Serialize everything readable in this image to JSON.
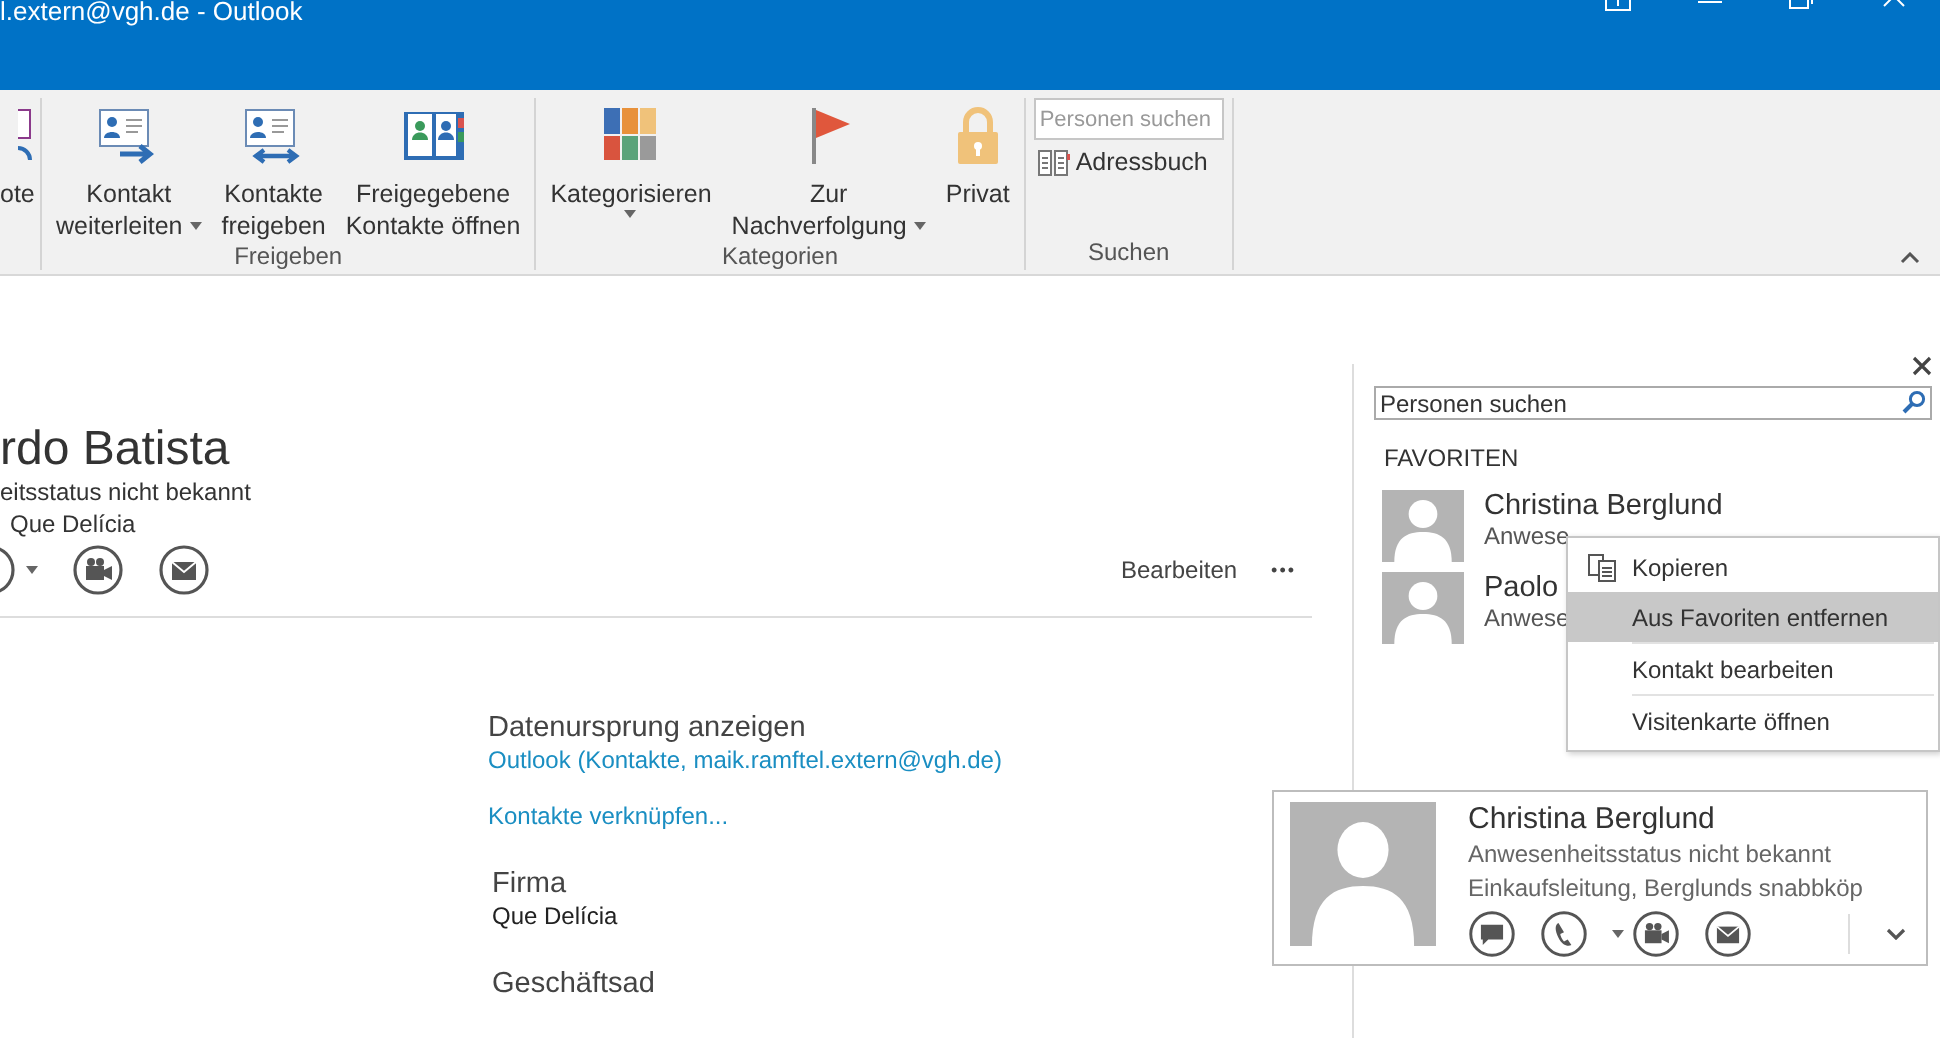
{
  "window": {
    "title": "l.extern@vgh.de - Outlook"
  },
  "ribbon": {
    "groups": [
      {
        "buttons": [
          {
            "kind": "partial",
            "lines": [
              "ote"
            ],
            "dropdown": false
          }
        ]
      },
      {
        "label": "Freigeben",
        "buttons": [
          {
            "kind": "forward",
            "lines": [
              "Kontakt",
              "weiterleiten"
            ],
            "dropdown": true
          },
          {
            "kind": "share",
            "lines": [
              "Kontakte",
              "freigeben"
            ],
            "dropdown": false
          },
          {
            "kind": "book",
            "lines": [
              "Freigegebene",
              "Kontakte öffnen"
            ],
            "dropdown": false
          }
        ]
      },
      {
        "label": "Kategorien",
        "buttons": [
          {
            "kind": "grid",
            "lines": [
              "Kategorisieren"
            ],
            "dropdown": true
          },
          {
            "kind": "flag",
            "lines": [
              "Zur",
              "Nachverfolgung"
            ],
            "dropdown": true
          },
          {
            "kind": "lock",
            "lines": [
              "Privat"
            ],
            "dropdown": false
          }
        ]
      },
      {
        "label": "Suchen",
        "search": {
          "placeholder": "Personen suchen"
        },
        "link": "Adressbuch"
      }
    ]
  },
  "contact": {
    "name": "rdo Batista",
    "presence": "eitsstatus nicht bekannt",
    "company": "Que Delícia",
    "edit": "Bearbeiten",
    "more": "•••"
  },
  "details": [
    {
      "heading": "Datenursprung anzeigen",
      "link": "Outlook (Kontakte, maik.ramftel.extern@vgh.de)"
    },
    {
      "link": "Kontakte verknüpfen..."
    },
    {
      "heading": "Firma",
      "value": "Que Delícia"
    },
    {
      "heading": "Geschäftsad"
    }
  ],
  "people_pane": {
    "search": {
      "placeholder": "Personen suchen"
    },
    "heading": "FAVORITEN",
    "favorites": [
      {
        "name": "Christina Berglund",
        "status": "Anwese"
      },
      {
        "name": "Paolo",
        "status": "Anwese"
      }
    ]
  },
  "context_menu": [
    {
      "label": "Kopieren",
      "icon": true,
      "selected": false
    },
    {
      "label": "Aus Favoriten entfernen",
      "icon": false,
      "selected": true
    },
    {
      "label": "Kontakt bearbeiten",
      "icon": false,
      "selected": false
    },
    {
      "label": "Visitenkarte öffnen",
      "icon": false,
      "selected": false
    }
  ],
  "contact_card": {
    "name": "Christina Berglund",
    "status": "Anwesenheitsstatus nicht bekannt",
    "job": "Einkaufsleitung, Berglunds snabbköp"
  }
}
